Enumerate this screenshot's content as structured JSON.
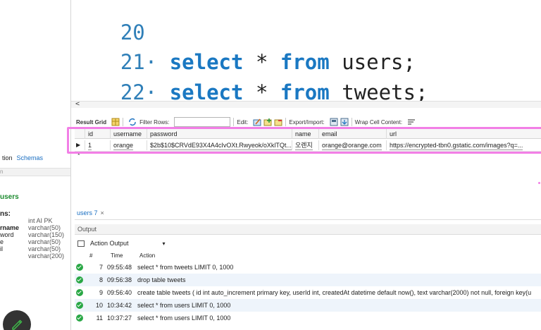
{
  "navigator": {
    "tabs": [
      "tion",
      "Schemas"
    ],
    "info_label": "n",
    "table_name": "users",
    "columns_heading": "ns:",
    "columns": [
      {
        "name": "",
        "type": "int AI PK"
      },
      {
        "name": "rname",
        "type": "varchar(50)"
      },
      {
        "name": "word",
        "type": "varchar(150)"
      },
      {
        "name": "e",
        "type": "varchar(50)"
      },
      {
        "name": "il",
        "type": "varchar(50)"
      },
      {
        "name": "",
        "type": "varchar(200)"
      }
    ]
  },
  "editor": {
    "lines": [
      {
        "num": "20",
        "dot": "",
        "kw1": "",
        "star": "",
        "kw2": "",
        "table": ""
      },
      {
        "num": "21",
        "dot": "·",
        "kw1": "select",
        "star": "*",
        "kw2": "from",
        "table": "users;"
      },
      {
        "num": "22",
        "dot": "·",
        "kw1": "select",
        "star": "*",
        "kw2": "from",
        "table": "tweets;"
      }
    ],
    "scroll_arrow": "<"
  },
  "result_toolbar": {
    "result_grid": "Result Grid",
    "filter_rows": "Filter Rows:",
    "edit": "Edit:",
    "export_import": "Export/Import:",
    "wrap_cell": "Wrap Cell Content:"
  },
  "grid": {
    "columns": [
      "id",
      "username",
      "password",
      "name",
      "email",
      "url"
    ],
    "rows": [
      [
        "1",
        "orange",
        "$2b$10$CRVdE93X4A4cIvOXt.Rwyeok/oXklTQt...",
        "오렌지",
        "orange@orange.com",
        "https://encrypted-tbn0.gstatic.com/images?q=..."
      ]
    ],
    "row_marker": "▶",
    "new_marker": "*"
  },
  "result_tabs": [
    {
      "label": "users 7",
      "close": "×"
    }
  ],
  "output": {
    "header": "Output",
    "selector_label": "Action Output",
    "selector_caret": "▾",
    "col_headers": {
      "num": "#",
      "time": "Time",
      "action": "Action"
    },
    "rows": [
      {
        "num": "7",
        "time": "09:55:48",
        "action": "select * from tweets LIMIT 0, 1000"
      },
      {
        "num": "8",
        "time": "09:56:38",
        "action": "drop table tweets"
      },
      {
        "num": "9",
        "time": "09:56:40",
        "action": "create table tweets ( id int auto_increment primary key,    userId int,    createdAt datetime default now(),    text varchar(2000) not null,    foreign key(u"
      },
      {
        "num": "10",
        "time": "10:34:42",
        "action": "select * from users LIMIT 0, 1000"
      },
      {
        "num": "11",
        "time": "10:37:27",
        "action": "select * from users LIMIT 0, 1000"
      }
    ]
  },
  "colors": {
    "keyword": "#1a78c2",
    "highlight": "#f27fe6",
    "ok": "#29a745",
    "table_name": "#1b8a2e"
  }
}
